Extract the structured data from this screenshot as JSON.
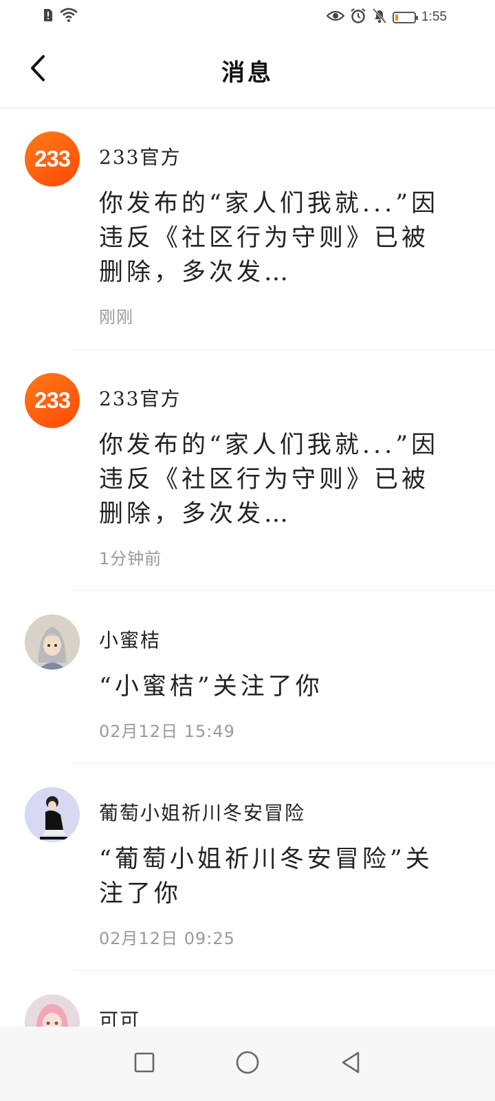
{
  "status_bar": {
    "time": "1:55",
    "battery_level": 0.15,
    "icons": [
      "sim-alert-icon",
      "wifi-icon",
      "eye-icon",
      "alarm-icon",
      "bell-off-icon",
      "battery-icon"
    ]
  },
  "header": {
    "title": "消息",
    "back_icon": "chevron-left-icon"
  },
  "messages": [
    {
      "avatar_text": "233",
      "sender": "233官方",
      "content": "你发布的“家人们我就...”因违反《社区行为守则》已被删除，多次发…",
      "time": "刚刚"
    },
    {
      "avatar_text": "233",
      "sender": "233官方",
      "content": "你发布的“家人们我就...”因违反《社区行为守则》已被删除，多次发…",
      "time": "1分钟前"
    },
    {
      "sender": "小蜜桔",
      "content": "“小蜜桔”关注了你",
      "time": "02月12日  15:49"
    },
    {
      "sender": "葡萄小姐祈川冬安冒险",
      "content": "“葡萄小姐祈川冬安冒险”关注了你",
      "time": "02月12日  09:25"
    },
    {
      "sender": "可可"
    }
  ],
  "colors": {
    "brand": "#ff5a0a",
    "timestamp": "#9a9a9a",
    "divider": "#ececec"
  }
}
